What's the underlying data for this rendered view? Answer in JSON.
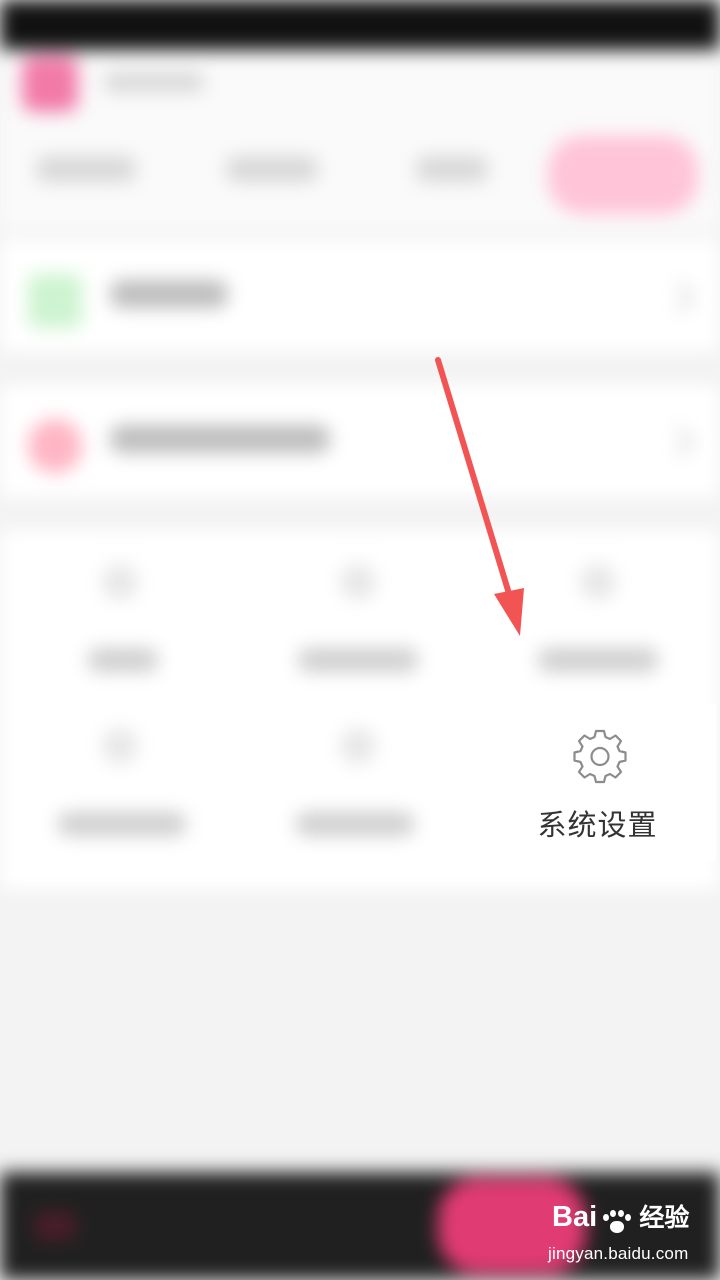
{
  "settings_item": {
    "label": "系统设置",
    "icon": "gear-icon"
  },
  "annotation": {
    "color": "#f25353",
    "icon": "arrow-icon"
  },
  "watermark": {
    "brand_prefix": "Bai",
    "brand_icon": "paw-icon",
    "brand_suffix": "经验",
    "url": "jingyan.baidu.com"
  },
  "colors": {
    "accent": "#e13b73",
    "focus_text": "#333333"
  }
}
